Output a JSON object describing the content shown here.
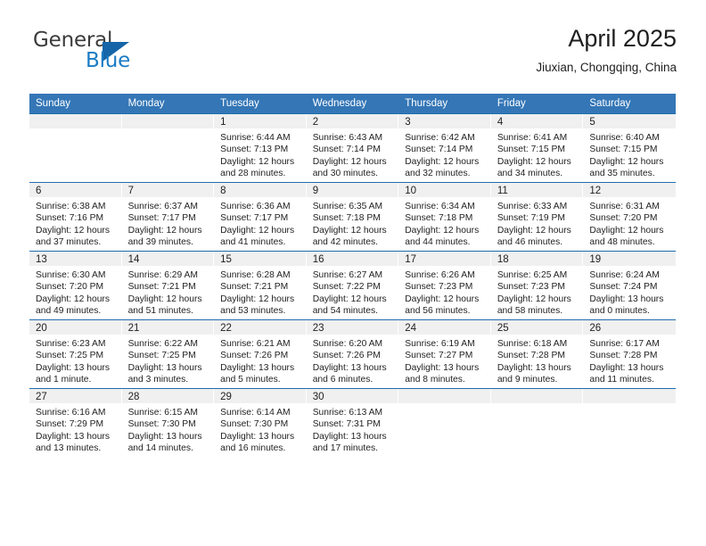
{
  "brand": {
    "name_top": "General",
    "name_bottom": "Blue",
    "accent_color": "#1a7bc4",
    "triangle_color": "#1565a8"
  },
  "header": {
    "title": "April 2025",
    "subtitle": "Jiuxian, Chongqing, China"
  },
  "calendar": {
    "header_bg": "#3476b6",
    "row_divider_color": "#1f6cb0",
    "daynum_band_bg": "#f0f0f0",
    "weekdays": [
      "Sunday",
      "Monday",
      "Tuesday",
      "Wednesday",
      "Thursday",
      "Friday",
      "Saturday"
    ],
    "weeks": [
      [
        {
          "day": "",
          "sunrise": "",
          "sunset": "",
          "daylight1": "",
          "daylight2": ""
        },
        {
          "day": "",
          "sunrise": "",
          "sunset": "",
          "daylight1": "",
          "daylight2": ""
        },
        {
          "day": "1",
          "sunrise": "Sunrise: 6:44 AM",
          "sunset": "Sunset: 7:13 PM",
          "daylight1": "Daylight: 12 hours",
          "daylight2": "and 28 minutes."
        },
        {
          "day": "2",
          "sunrise": "Sunrise: 6:43 AM",
          "sunset": "Sunset: 7:14 PM",
          "daylight1": "Daylight: 12 hours",
          "daylight2": "and 30 minutes."
        },
        {
          "day": "3",
          "sunrise": "Sunrise: 6:42 AM",
          "sunset": "Sunset: 7:14 PM",
          "daylight1": "Daylight: 12 hours",
          "daylight2": "and 32 minutes."
        },
        {
          "day": "4",
          "sunrise": "Sunrise: 6:41 AM",
          "sunset": "Sunset: 7:15 PM",
          "daylight1": "Daylight: 12 hours",
          "daylight2": "and 34 minutes."
        },
        {
          "day": "5",
          "sunrise": "Sunrise: 6:40 AM",
          "sunset": "Sunset: 7:15 PM",
          "daylight1": "Daylight: 12 hours",
          "daylight2": "and 35 minutes."
        }
      ],
      [
        {
          "day": "6",
          "sunrise": "Sunrise: 6:38 AM",
          "sunset": "Sunset: 7:16 PM",
          "daylight1": "Daylight: 12 hours",
          "daylight2": "and 37 minutes."
        },
        {
          "day": "7",
          "sunrise": "Sunrise: 6:37 AM",
          "sunset": "Sunset: 7:17 PM",
          "daylight1": "Daylight: 12 hours",
          "daylight2": "and 39 minutes."
        },
        {
          "day": "8",
          "sunrise": "Sunrise: 6:36 AM",
          "sunset": "Sunset: 7:17 PM",
          "daylight1": "Daylight: 12 hours",
          "daylight2": "and 41 minutes."
        },
        {
          "day": "9",
          "sunrise": "Sunrise: 6:35 AM",
          "sunset": "Sunset: 7:18 PM",
          "daylight1": "Daylight: 12 hours",
          "daylight2": "and 42 minutes."
        },
        {
          "day": "10",
          "sunrise": "Sunrise: 6:34 AM",
          "sunset": "Sunset: 7:18 PM",
          "daylight1": "Daylight: 12 hours",
          "daylight2": "and 44 minutes."
        },
        {
          "day": "11",
          "sunrise": "Sunrise: 6:33 AM",
          "sunset": "Sunset: 7:19 PM",
          "daylight1": "Daylight: 12 hours",
          "daylight2": "and 46 minutes."
        },
        {
          "day": "12",
          "sunrise": "Sunrise: 6:31 AM",
          "sunset": "Sunset: 7:20 PM",
          "daylight1": "Daylight: 12 hours",
          "daylight2": "and 48 minutes."
        }
      ],
      [
        {
          "day": "13",
          "sunrise": "Sunrise: 6:30 AM",
          "sunset": "Sunset: 7:20 PM",
          "daylight1": "Daylight: 12 hours",
          "daylight2": "and 49 minutes."
        },
        {
          "day": "14",
          "sunrise": "Sunrise: 6:29 AM",
          "sunset": "Sunset: 7:21 PM",
          "daylight1": "Daylight: 12 hours",
          "daylight2": "and 51 minutes."
        },
        {
          "day": "15",
          "sunrise": "Sunrise: 6:28 AM",
          "sunset": "Sunset: 7:21 PM",
          "daylight1": "Daylight: 12 hours",
          "daylight2": "and 53 minutes."
        },
        {
          "day": "16",
          "sunrise": "Sunrise: 6:27 AM",
          "sunset": "Sunset: 7:22 PM",
          "daylight1": "Daylight: 12 hours",
          "daylight2": "and 54 minutes."
        },
        {
          "day": "17",
          "sunrise": "Sunrise: 6:26 AM",
          "sunset": "Sunset: 7:23 PM",
          "daylight1": "Daylight: 12 hours",
          "daylight2": "and 56 minutes."
        },
        {
          "day": "18",
          "sunrise": "Sunrise: 6:25 AM",
          "sunset": "Sunset: 7:23 PM",
          "daylight1": "Daylight: 12 hours",
          "daylight2": "and 58 minutes."
        },
        {
          "day": "19",
          "sunrise": "Sunrise: 6:24 AM",
          "sunset": "Sunset: 7:24 PM",
          "daylight1": "Daylight: 13 hours",
          "daylight2": "and 0 minutes."
        }
      ],
      [
        {
          "day": "20",
          "sunrise": "Sunrise: 6:23 AM",
          "sunset": "Sunset: 7:25 PM",
          "daylight1": "Daylight: 13 hours",
          "daylight2": "and 1 minute."
        },
        {
          "day": "21",
          "sunrise": "Sunrise: 6:22 AM",
          "sunset": "Sunset: 7:25 PM",
          "daylight1": "Daylight: 13 hours",
          "daylight2": "and 3 minutes."
        },
        {
          "day": "22",
          "sunrise": "Sunrise: 6:21 AM",
          "sunset": "Sunset: 7:26 PM",
          "daylight1": "Daylight: 13 hours",
          "daylight2": "and 5 minutes."
        },
        {
          "day": "23",
          "sunrise": "Sunrise: 6:20 AM",
          "sunset": "Sunset: 7:26 PM",
          "daylight1": "Daylight: 13 hours",
          "daylight2": "and 6 minutes."
        },
        {
          "day": "24",
          "sunrise": "Sunrise: 6:19 AM",
          "sunset": "Sunset: 7:27 PM",
          "daylight1": "Daylight: 13 hours",
          "daylight2": "and 8 minutes."
        },
        {
          "day": "25",
          "sunrise": "Sunrise: 6:18 AM",
          "sunset": "Sunset: 7:28 PM",
          "daylight1": "Daylight: 13 hours",
          "daylight2": "and 9 minutes."
        },
        {
          "day": "26",
          "sunrise": "Sunrise: 6:17 AM",
          "sunset": "Sunset: 7:28 PM",
          "daylight1": "Daylight: 13 hours",
          "daylight2": "and 11 minutes."
        }
      ],
      [
        {
          "day": "27",
          "sunrise": "Sunrise: 6:16 AM",
          "sunset": "Sunset: 7:29 PM",
          "daylight1": "Daylight: 13 hours",
          "daylight2": "and 13 minutes."
        },
        {
          "day": "28",
          "sunrise": "Sunrise: 6:15 AM",
          "sunset": "Sunset: 7:30 PM",
          "daylight1": "Daylight: 13 hours",
          "daylight2": "and 14 minutes."
        },
        {
          "day": "29",
          "sunrise": "Sunrise: 6:14 AM",
          "sunset": "Sunset: 7:30 PM",
          "daylight1": "Daylight: 13 hours",
          "daylight2": "and 16 minutes."
        },
        {
          "day": "30",
          "sunrise": "Sunrise: 6:13 AM",
          "sunset": "Sunset: 7:31 PM",
          "daylight1": "Daylight: 13 hours",
          "daylight2": "and 17 minutes."
        },
        {
          "day": "",
          "sunrise": "",
          "sunset": "",
          "daylight1": "",
          "daylight2": ""
        },
        {
          "day": "",
          "sunrise": "",
          "sunset": "",
          "daylight1": "",
          "daylight2": ""
        },
        {
          "day": "",
          "sunrise": "",
          "sunset": "",
          "daylight1": "",
          "daylight2": ""
        }
      ]
    ]
  }
}
